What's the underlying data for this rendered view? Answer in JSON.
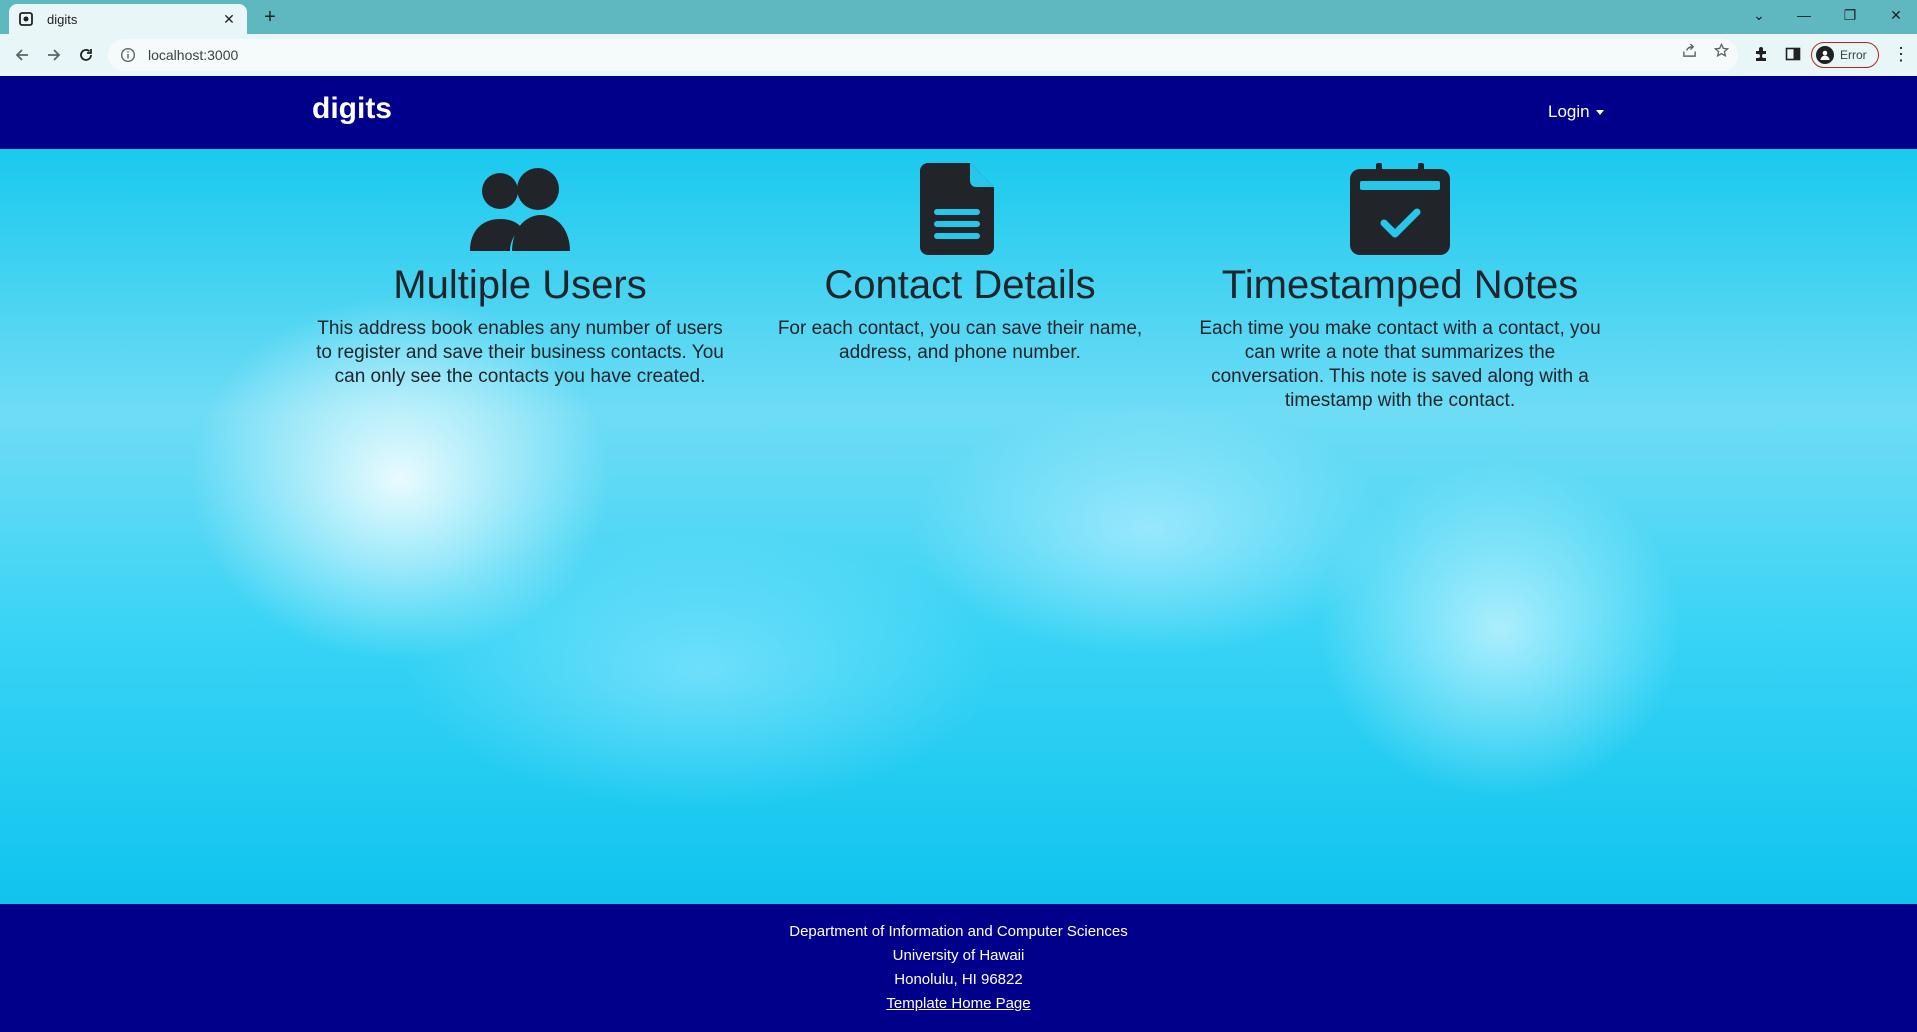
{
  "browser": {
    "tab_title": "digits",
    "tab_close": "✕",
    "new_tab": "+",
    "url": "localhost:3000",
    "profile_label": "Error",
    "window_controls": [
      "⌄",
      "—",
      "❐",
      "✕"
    ]
  },
  "navbar": {
    "brand": "digits",
    "login_label": "Login"
  },
  "features": [
    {
      "icon": "users-icon",
      "title": "Multiple Users",
      "text": "This address book enables any number of users to register and save their business contacts. You can only see the contacts you have created."
    },
    {
      "icon": "file-lines-icon",
      "title": "Contact Details",
      "text": "For each contact, you can save their name, address, and phone number."
    },
    {
      "icon": "calendar-check-icon",
      "title": "Timestamped Notes",
      "text": "Each time you make contact with a contact, you can write a note that summarizes the conversation. This note is saved along with a timestamp with the contact."
    }
  ],
  "footer": {
    "line1": "Department of Information and Computer Sciences",
    "line2": "University of Hawaii",
    "line3": "Honolulu, HI 96822",
    "link": "Template Home Page"
  },
  "colors": {
    "navbar": "#00008b",
    "footer": "#00008b",
    "icon": "#212529",
    "accent": "#29c6ec"
  }
}
